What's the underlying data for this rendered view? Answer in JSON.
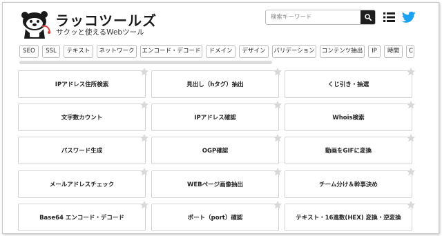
{
  "header": {
    "title": "ラッコツールズ",
    "tagline": "サクッと使えるWebツール"
  },
  "search": {
    "placeholder": "検索キーワード"
  },
  "icons": {
    "logo": "otter-mascot-logo",
    "search": "search-icon",
    "menu": "list-icon",
    "social": "twitter-bird-icon",
    "favorite": "star-icon"
  },
  "colors": {
    "twitter_blue": "#1da1f2",
    "search_button": "#1e1e1e",
    "star": "#d9d9d9"
  },
  "tags": [
    "SEO",
    "SSL",
    "テキスト",
    "ネットワーク",
    "エンコード・デコード",
    "ドメイン",
    "デザイン",
    "バリデーション",
    "コンテンツ抽出",
    "IP",
    "時間",
    "C"
  ],
  "tools": [
    "IPアドレス住所検索",
    "見出し（hタグ）抽出",
    "くじ引き・抽選",
    "文字数カウント",
    "IPアドレス確認",
    "Whois検索",
    "パスワード生成",
    "OGP確認",
    "動画をGIFに変換",
    "メールアドレスチェック",
    "WEBページ画像抽出",
    "チーム分け＆幹事決め",
    "Base64 エンコード・デコード",
    "ポート（port）確認",
    "テキスト・16進数(HEX) 変換・逆変換"
  ]
}
